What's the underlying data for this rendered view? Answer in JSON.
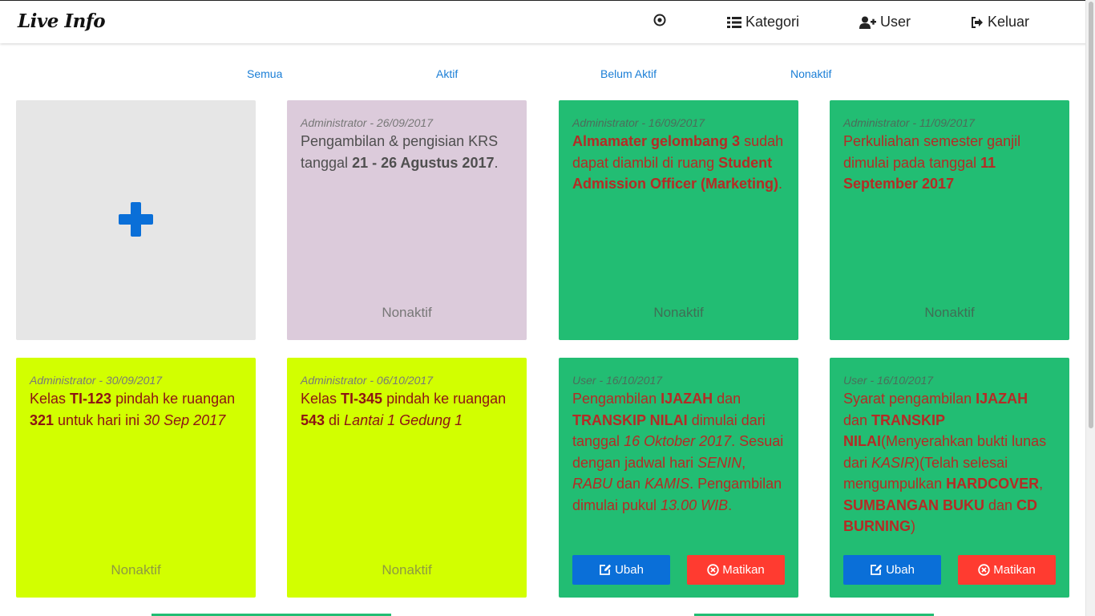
{
  "app": {
    "brand": "Live Info"
  },
  "nav": {
    "kategori": "Kategori",
    "user": "User",
    "keluar": "Keluar"
  },
  "tabs": [
    "Semua",
    "Aktif",
    "Belum Aktif",
    "Nonaktif"
  ],
  "buttons": {
    "ubah": "Ubah",
    "matikan": "Matikan"
  },
  "colors": {
    "purple": "#dccbdb",
    "green": "#22bd73",
    "lime": "#d2ff00",
    "add": "#e6e6e6",
    "primary": "#0a6fd8",
    "danger": "#ff3b30"
  },
  "cards": [
    {
      "meta": "Administrator - 26/09/2017",
      "status": "Nonaktif",
      "body": [
        "Pengambilan & pengisian KRS tanggal ",
        "21 - 26 Agustus 2017",
        "."
      ]
    },
    {
      "meta": "Administrator - 16/09/2017",
      "status": "Nonaktif",
      "body": [
        "Almamater gelombang 3",
        " sudah dapat diambil di ruang ",
        "Student Admission Officer (Marketing)",
        "."
      ]
    },
    {
      "meta": "Administrator - 11/09/2017",
      "status": "Nonaktif",
      "body": [
        "Perkuliahan semester ganjil dimulai pada tanggal ",
        "11 September 2017"
      ]
    },
    {
      "meta": "Administrator - 30/09/2017",
      "status": "Nonaktif",
      "body": [
        "Kelas ",
        "TI-123",
        " pindah ke ruangan ",
        "321",
        " untuk hari ini ",
        "30 Sep 2017"
      ]
    },
    {
      "meta": "Administrator - 06/10/2017",
      "status": "Nonaktif",
      "body": [
        "Kelas ",
        "TI-345",
        " pindah ke ruangan ",
        "543",
        " di ",
        "Lantai 1 Gedung 1"
      ]
    },
    {
      "meta": "User - 16/10/2017",
      "body": [
        "Pengambilan ",
        "IJAZAH",
        " dan ",
        "TRANSKIP NILAI",
        " dimulai dari tanggal ",
        "16 Oktober 2017",
        ". Sesuai dengan jadwal hari ",
        "SENIN",
        ", ",
        "RABU",
        " dan ",
        "KAMIS",
        ". Pengambilan dimulai pukul ",
        "13.00 WIB",
        "."
      ]
    },
    {
      "meta": "User - 16/10/2017",
      "body": [
        "Syarat pengambilan ",
        "IJAZAH",
        " dan ",
        "TRANSKIP NILAI",
        "(Menyerahkan bukti lunas dari ",
        "KASIR",
        ")(Telah selesai mengumpulkan ",
        "HARDCOVER",
        ", ",
        "SUMBANGAN BUKU",
        " dan ",
        "CD BURNING",
        ")"
      ]
    }
  ]
}
